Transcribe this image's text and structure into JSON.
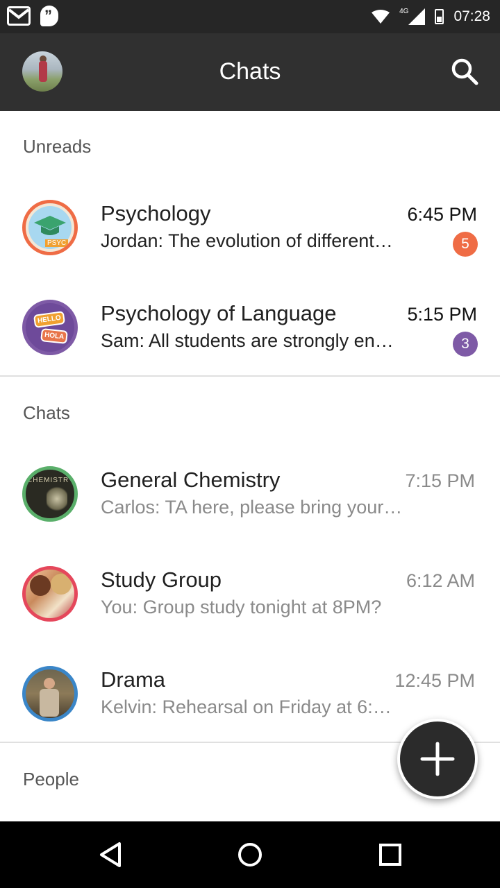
{
  "status_bar": {
    "network": "4G",
    "time": "07:28"
  },
  "app_bar": {
    "title": "Chats"
  },
  "sections": {
    "unreads": "Unreads",
    "chats": "Chats",
    "people": "People"
  },
  "unread_chats": [
    {
      "title": "Psychology",
      "preview": "Jordan: The evolution of different…",
      "time": "6:45 PM",
      "badge": "5",
      "badge_color": "#ef6c45",
      "ring_color": "#ef6c45"
    },
    {
      "title": "Psychology of Language",
      "preview": "Sam: All students are strongly en…",
      "time": "5:15 PM",
      "badge": "3",
      "badge_color": "#7e5aa6",
      "ring_color": "#7e5aa6"
    }
  ],
  "chats": [
    {
      "title": "General Chemistry",
      "preview": "Carlos: TA here, please bring your…",
      "time": "7:15 PM",
      "ring_color": "#5aaf6a"
    },
    {
      "title": "Study Group",
      "preview": "You: Group study tonight at 8PM?",
      "time": "6:12 AM",
      "ring_color": "#e5475b"
    },
    {
      "title": "Drama",
      "preview": "Kelvin: Rehearsal on Friday at 6:…",
      "time": "12:45 PM",
      "ring_color": "#3a86c8"
    }
  ],
  "avatar_texts": {
    "psyc": "PSYC",
    "hello": "HELLO",
    "hola": "HOLA",
    "chemistry": "CHEMISTR"
  },
  "colors": {
    "status_bar": "#262626",
    "app_bar": "#303030",
    "fab": "#2b2b2b"
  },
  "icons": {
    "search": "search-icon",
    "fab": "plus-icon",
    "nav_back": "triangle-back-icon",
    "nav_home": "circle-home-icon",
    "nav_recents": "square-recents-icon"
  }
}
